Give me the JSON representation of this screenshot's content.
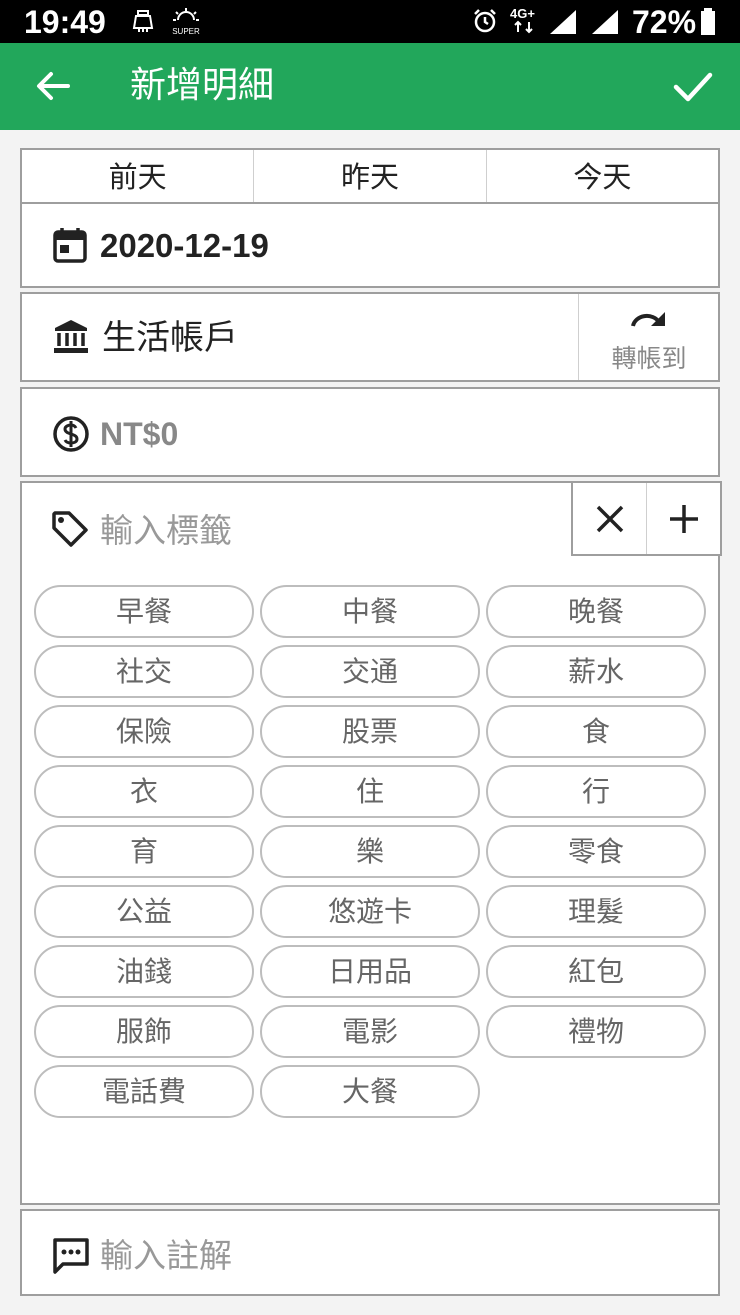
{
  "status_bar": {
    "time": "19:49",
    "battery_percent": "72%",
    "network_label": "4G+",
    "icons": [
      "cleaner-icon",
      "super-mode-icon",
      "alarm-icon",
      "network-4g-icon",
      "signal-icon",
      "signal-icon",
      "battery-icon"
    ]
  },
  "app_bar": {
    "title": "新增明細",
    "back_icon": "arrow-left-icon",
    "confirm_icon": "check-icon",
    "color": "#22a75b"
  },
  "quick_days": [
    "前天",
    "昨天",
    "今天"
  ],
  "date": {
    "value": "2020-12-19",
    "icon": "calendar-icon"
  },
  "account": {
    "name": "生活帳戶",
    "icon": "bank-icon",
    "transfer_label": "轉帳到",
    "transfer_icon": "redo-icon"
  },
  "amount": {
    "placeholder": "NT$0",
    "icon": "dollar-circle-icon"
  },
  "tags": {
    "placeholder": "輸入標籤",
    "icon": "tag-icon",
    "clear_icon": "close-icon",
    "add_icon": "plus-icon",
    "items": [
      "早餐",
      "中餐",
      "晚餐",
      "社交",
      "交通",
      "薪水",
      "保險",
      "股票",
      "食",
      "衣",
      "住",
      "行",
      "育",
      "樂",
      "零食",
      "公益",
      "悠遊卡",
      "理髮",
      "油錢",
      "日用品",
      "紅包",
      "服飾",
      "電影",
      "禮物",
      "電話費",
      "大餐"
    ]
  },
  "note": {
    "placeholder": "輸入註解",
    "icon": "comment-icon"
  }
}
